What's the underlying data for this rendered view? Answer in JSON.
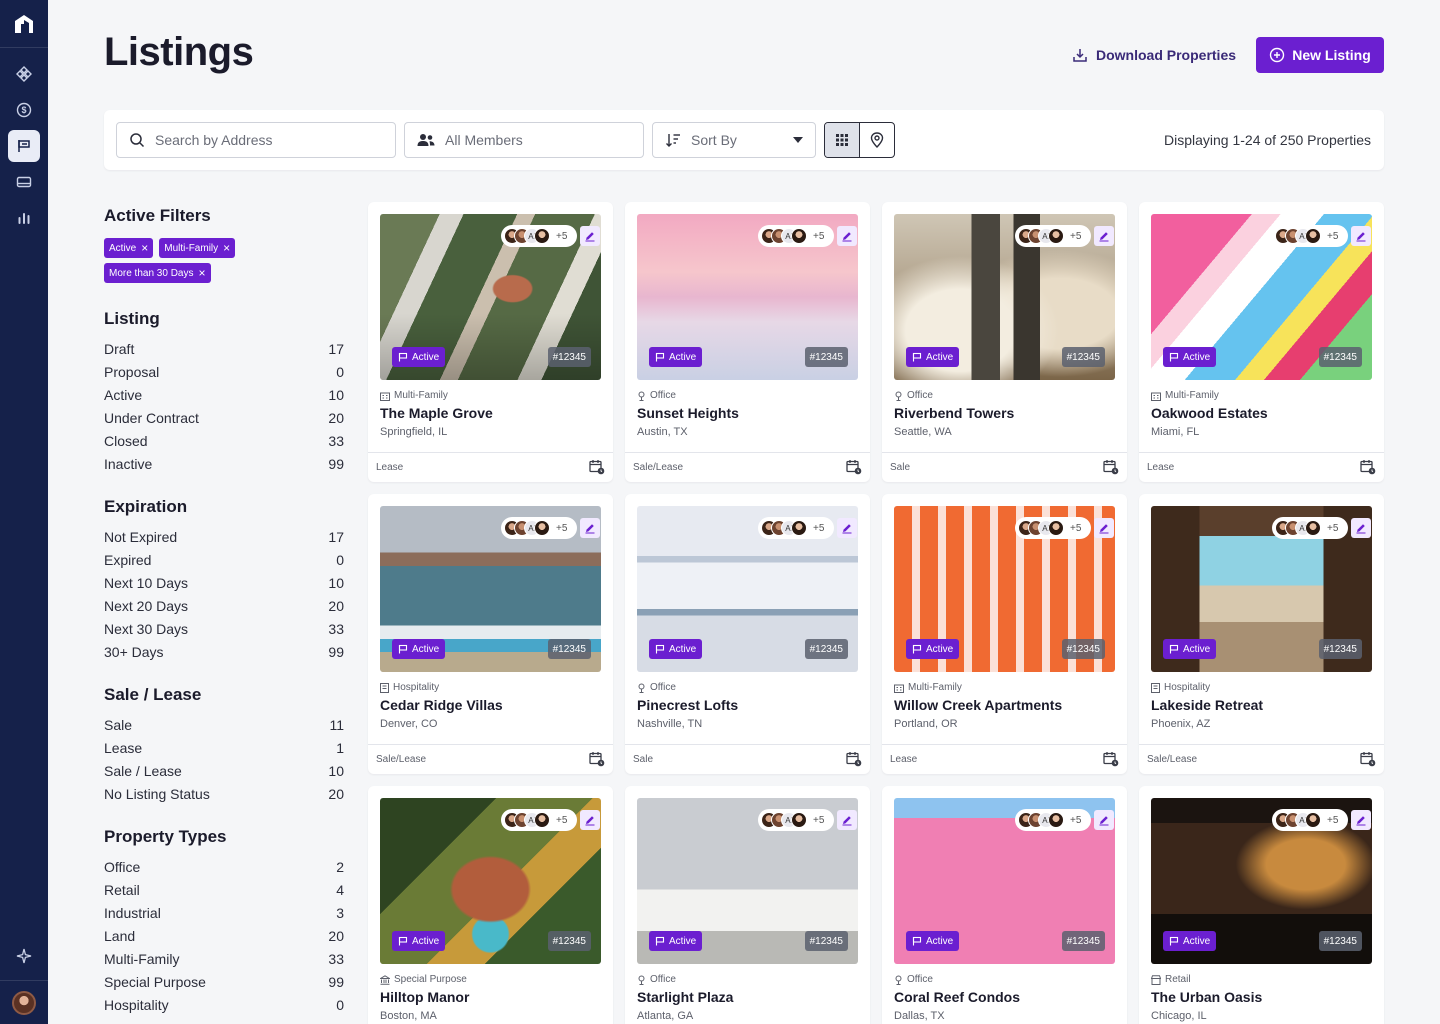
{
  "page": {
    "title": "Listings"
  },
  "header": {
    "download_label": "Download Properties",
    "new_listing_label": "New Listing"
  },
  "toolbar": {
    "search_placeholder": "Search by Address",
    "members_label": "All Members",
    "sort_label": "Sort By",
    "displaying": "Displaying 1-24 of 250 Properties"
  },
  "filters": {
    "active_title": "Active Filters",
    "chips": [
      "Active",
      "Multi-Family",
      "More than 30 Days"
    ],
    "groups": [
      {
        "title": "Listing",
        "rows": [
          {
            "label": "Draft",
            "count": "17"
          },
          {
            "label": "Proposal",
            "count": "0"
          },
          {
            "label": "Active",
            "count": "10"
          },
          {
            "label": "Under Contract",
            "count": "20"
          },
          {
            "label": "Closed",
            "count": "33"
          },
          {
            "label": "Inactive",
            "count": "99"
          }
        ]
      },
      {
        "title": "Expiration",
        "rows": [
          {
            "label": "Not Expired",
            "count": "17"
          },
          {
            "label": "Expired",
            "count": "0"
          },
          {
            "label": "Next 10 Days",
            "count": "10"
          },
          {
            "label": "Next 20 Days",
            "count": "20"
          },
          {
            "label": "Next 30 Days",
            "count": "33"
          },
          {
            "label": "30+ Days",
            "count": "99"
          }
        ]
      },
      {
        "title": "Sale / Lease",
        "rows": [
          {
            "label": "Sale",
            "count": "11"
          },
          {
            "label": "Lease",
            "count": "1"
          },
          {
            "label": "Sale / Lease",
            "count": "10"
          },
          {
            "label": "No Listing Status",
            "count": "20"
          }
        ]
      },
      {
        "title": "Property Types",
        "rows": [
          {
            "label": "Office",
            "count": "2"
          },
          {
            "label": "Retail",
            "count": "4"
          },
          {
            "label": "Industrial",
            "count": "3"
          },
          {
            "label": "Land",
            "count": "20"
          },
          {
            "label": "Multi-Family",
            "count": "33"
          },
          {
            "label": "Special Purpose",
            "count": "99"
          },
          {
            "label": "Hospitality",
            "count": "0"
          }
        ]
      }
    ]
  },
  "card_common": {
    "status": "Active",
    "id": "#12345",
    "ai": "AI",
    "more": "+5"
  },
  "listings": [
    {
      "type": "Multi-Family",
      "name": "The Maple Grove",
      "location": "Springfield, IL",
      "listing_type": "Lease"
    },
    {
      "type": "Office",
      "name": "Sunset Heights",
      "location": "Austin, TX",
      "listing_type": "Sale/Lease"
    },
    {
      "type": "Office",
      "name": "Riverbend Towers",
      "location": "Seattle, WA",
      "listing_type": "Sale"
    },
    {
      "type": "Multi-Family",
      "name": "Oakwood Estates",
      "location": "Miami, FL",
      "listing_type": "Lease"
    },
    {
      "type": "Hospitality",
      "name": "Cedar Ridge Villas",
      "location": "Denver, CO",
      "listing_type": "Sale/Lease"
    },
    {
      "type": "Office",
      "name": "Pinecrest Lofts",
      "location": "Nashville, TN",
      "listing_type": "Sale"
    },
    {
      "type": "Multi-Family",
      "name": "Willow Creek Apartments",
      "location": "Portland, OR",
      "listing_type": "Lease"
    },
    {
      "type": "Hospitality",
      "name": "Lakeside Retreat",
      "location": "Phoenix, AZ",
      "listing_type": "Sale/Lease"
    },
    {
      "type": "Special Purpose",
      "name": "Hilltop Manor",
      "location": "Boston, MA",
      "listing_type": ""
    },
    {
      "type": "Office",
      "name": "Starlight Plaza",
      "location": "Atlanta, GA",
      "listing_type": ""
    },
    {
      "type": "Office",
      "name": "Coral Reef Condos",
      "location": "Dallas, TX",
      "listing_type": ""
    },
    {
      "type": "Retail",
      "name": "The Urban Oasis",
      "location": "Chicago, IL",
      "listing_type": ""
    }
  ]
}
